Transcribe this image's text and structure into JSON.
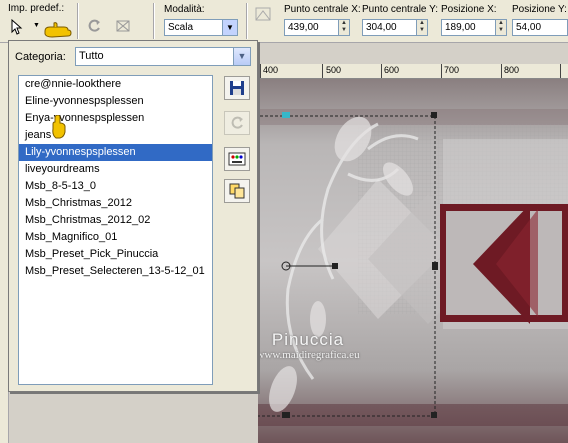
{
  "toolbar": {
    "presets_label": "Imp. predef.:",
    "mode_label": "Modalità:",
    "mode_value": "Scala",
    "center_x_label": "Punto centrale X:",
    "center_x_value": "439,00",
    "center_y_label": "Punto centrale Y:",
    "center_y_value": "304,00",
    "pos_x_label": "Posizione X:",
    "pos_x_value": "189,00",
    "pos_y_label": "Posizione Y:",
    "pos_y_value": "54,00"
  },
  "panel": {
    "category_label": "Categoria:",
    "category_value": "Tutto",
    "items": [
      "cre@nnie-lookthere",
      "Eline-yvonnespsplessen",
      "Enya-yvonnespsplessen",
      "jeans",
      "Lily-yvonnespsplessen",
      "liveyourdreams",
      "Msb_8-5-13_0",
      "Msb_Christmas_2012",
      "Msb_Christmas_2012_02",
      "Msb_Magnifico_01",
      "Msb_Preset_Pick_Pinuccia",
      "Msb_Preset_Selecteren_13-5-12_01"
    ],
    "selected_index": 4
  },
  "ruler": {
    "marks": [
      "400",
      "500",
      "600",
      "700",
      "800"
    ]
  },
  "watermark": {
    "title": "Pinuccia",
    "url": "www.maidiregrafica.eu"
  },
  "colors": {
    "accent": "#316ac5",
    "shape": "#6e1a24",
    "toolbar": "#ece9d8"
  },
  "icons": [
    "pointer-icon",
    "hand-pointer-icon",
    "save-preset-icon",
    "reset-icon",
    "options-icon",
    "copy-icon"
  ]
}
